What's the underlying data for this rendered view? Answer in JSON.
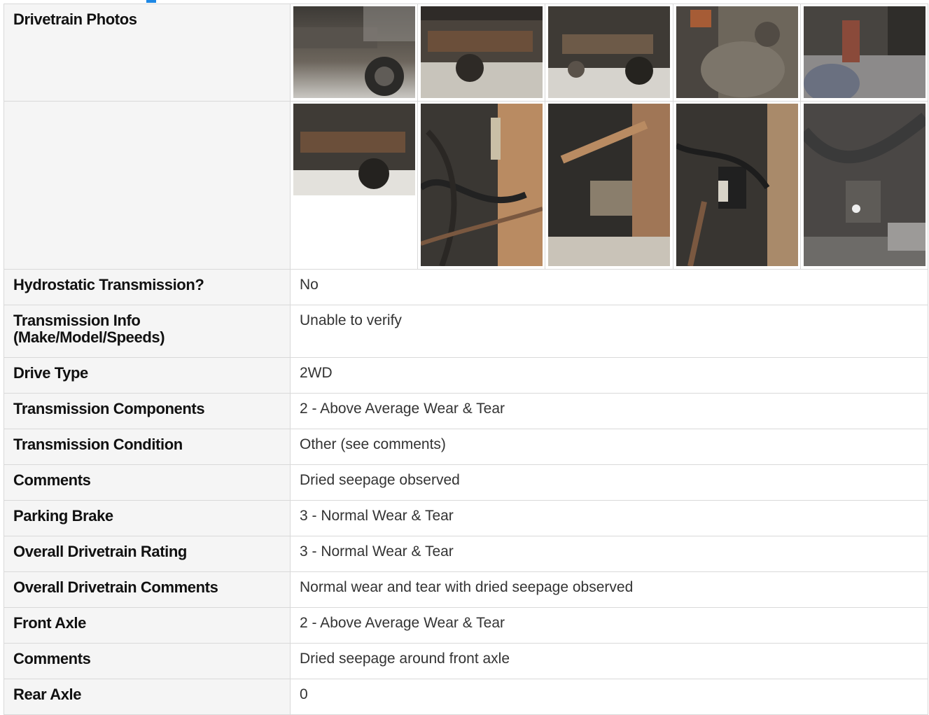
{
  "drivetrain_photos": {
    "label": "Drivetrain Photos",
    "row1": [
      "photo-1",
      "photo-2",
      "photo-3",
      "photo-4",
      "photo-5"
    ],
    "row2": [
      "photo-6",
      "photo-7",
      "photo-8",
      "photo-9",
      "photo-10"
    ]
  },
  "fields": [
    {
      "label": "Hydrostatic Transmission?",
      "value": "No"
    },
    {
      "label": "Transmission Info (Make/Model/Speeds)",
      "value": "Unable to verify"
    },
    {
      "label": "Drive Type",
      "value": "2WD"
    },
    {
      "label": "Transmission Components",
      "value": "2 - Above Average Wear & Tear"
    },
    {
      "label": "Transmission Condition",
      "value": "Other (see comments)"
    },
    {
      "label": "Comments",
      "value": "Dried seepage observed"
    },
    {
      "label": "Parking Brake",
      "value": "3 - Normal Wear & Tear"
    },
    {
      "label": "Overall Drivetrain Rating",
      "value": "3 - Normal Wear & Tear"
    },
    {
      "label": "Overall Drivetrain Comments",
      "value": "Normal wear and tear with dried seepage observed"
    },
    {
      "label": "Front Axle",
      "value": "2 - Above Average Wear & Tear"
    },
    {
      "label": "Comments",
      "value": "Dried seepage around front axle"
    },
    {
      "label": "Rear Axle",
      "value": "0"
    }
  ],
  "accent_color": "#1e88e5"
}
